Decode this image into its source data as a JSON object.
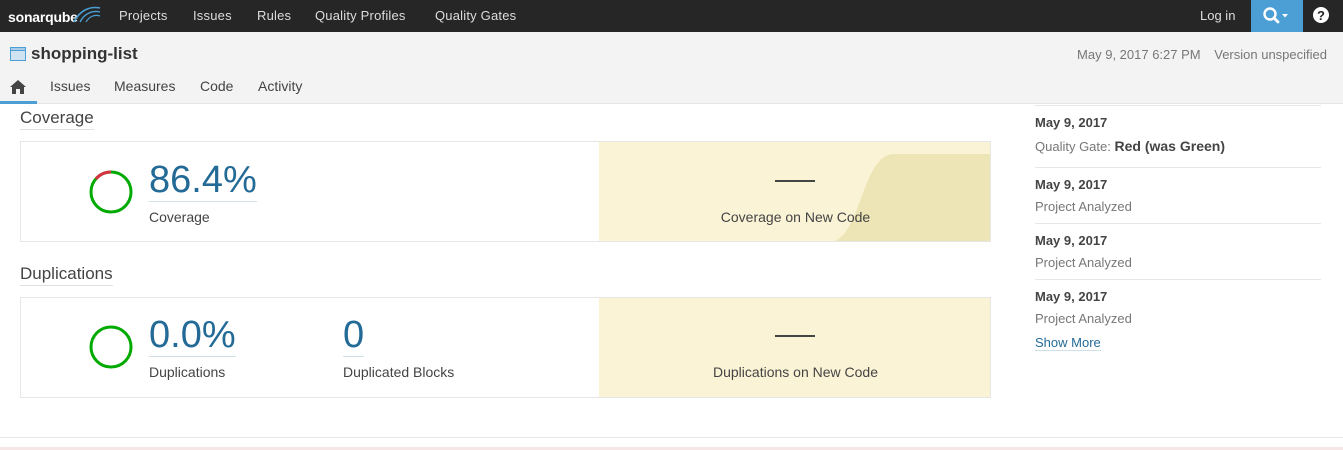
{
  "topbar": {
    "logo": "sonarqube",
    "nav": [
      "Projects",
      "Issues",
      "Rules",
      "Quality Profiles",
      "Quality Gates"
    ],
    "login": "Log in",
    "search_icon": "search-icon",
    "help_icon": "help-icon",
    "help_glyph": "?"
  },
  "project": {
    "name": "shopping-list",
    "date": "May 9, 2017 6:27 PM",
    "version": "Version unspecified",
    "tabs": [
      "Issues",
      "Measures",
      "Code",
      "Activity"
    ],
    "home_icon": "home-icon"
  },
  "coverage": {
    "title": "Coverage",
    "value": "86.4%",
    "value_fraction": 0.864,
    "label": "Coverage",
    "new_dash": "—",
    "new_label": "Coverage on New Code"
  },
  "duplications": {
    "title": "Duplications",
    "value": "0.0%",
    "label": "Duplications",
    "blocks_value": "0",
    "blocks_label": "Duplicated Blocks",
    "new_dash": "—",
    "new_label": "Duplications on New Code"
  },
  "events": [
    {
      "date": "May 9, 2017",
      "prefix": "Quality Gate:",
      "text": "Red (was Green)"
    },
    {
      "date": "May 9, 2017",
      "text": "Project Analyzed"
    },
    {
      "date": "May 9, 2017",
      "text": "Project Analyzed"
    },
    {
      "date": "May 9, 2017",
      "text": "Project Analyzed"
    }
  ],
  "show_more": "Show More",
  "colors": {
    "accent": "#4b9fd5",
    "link": "#236a97",
    "ok": "#00aa00",
    "error": "#d4333f",
    "new_code_bg": "#faf3d6"
  }
}
